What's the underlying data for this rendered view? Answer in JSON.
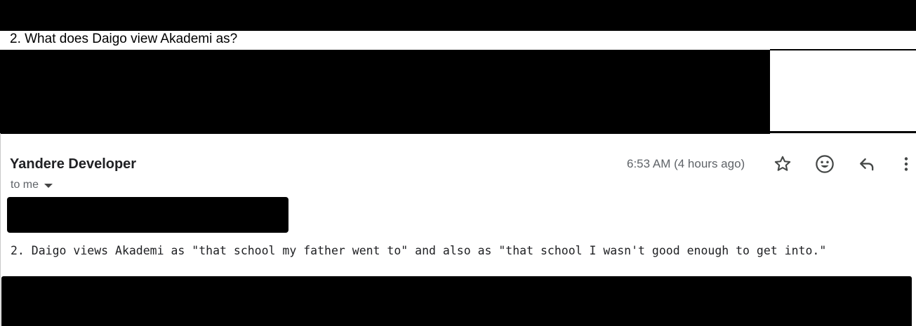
{
  "quoted_question": "2. What does Daigo view Akademi as?",
  "message": {
    "sender_name": "Yandere Developer",
    "recipient_label": "to me",
    "timestamp": "6:53 AM (4 hours ago)",
    "body": "2. Daigo views Akademi as \"that school my father went to\" and also as \"that school I wasn't good enough to get into.\""
  },
  "actions": {
    "star_icon": "star-outline",
    "emoji_icon": "smiley-face",
    "reply_icon": "reply-arrow",
    "more_icon": "vertical-dots"
  },
  "colors": {
    "redaction": "#000000",
    "text_primary": "#202124",
    "text_secondary": "#5f6368",
    "icon": "#444746"
  }
}
